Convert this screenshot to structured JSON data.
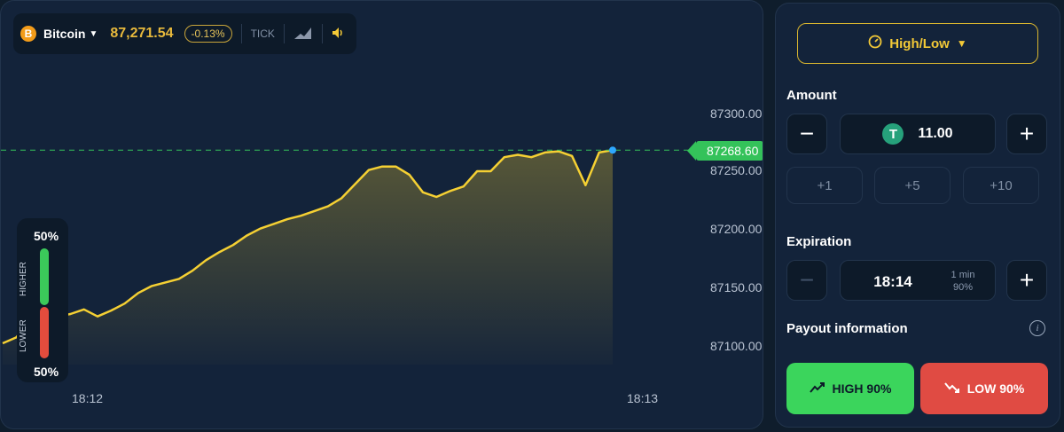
{
  "header": {
    "asset_icon": "B",
    "asset_name": "Bitcoin",
    "price": "87,271.54",
    "change": "-0.13%",
    "tick_label": "TICK"
  },
  "chart": {
    "price_labels": [
      "87300.00",
      "87250.00",
      "87200.00",
      "87150.00",
      "87100.00"
    ],
    "current_price": "87268.60",
    "time_labels": [
      "18:12",
      "18:13"
    ],
    "line_color": "#f5d033",
    "price_line_color": "#34c25a"
  },
  "sentiment": {
    "higher_percent": "50%",
    "lower_percent": "50%",
    "higher_label": "HIGHER",
    "lower_label": "LOWER"
  },
  "sidebar": {
    "mode": "High/Low",
    "amount_label": "Amount",
    "amount_value": "11.00",
    "currency_icon": "T",
    "minus": "−",
    "plus": "+",
    "quick_add": [
      "+1",
      "+5",
      "+10"
    ],
    "expiration_label": "Expiration",
    "expiration_time": "18:14",
    "expiration_duration": "1 min",
    "expiration_payout": "90%",
    "payout_label": "Payout information",
    "info_icon": "i",
    "high_button": "HIGH 90%",
    "low_button": "LOW 90%"
  },
  "colors": {
    "high": "#3bd55c",
    "low": "#e04b43",
    "accent": "#f3c937"
  },
  "chart_data": {
    "type": "area",
    "x": [
      "18:12",
      "18:13"
    ],
    "series": [
      {
        "values": [
          87103,
          87108,
          87122,
          87124,
          87126,
          87128,
          87132,
          87126,
          87131,
          87137,
          87146,
          87152,
          87155,
          87158,
          87165,
          87174,
          87181,
          87187,
          87195,
          87201,
          87205,
          87209,
          87212,
          87216,
          87220,
          87227,
          87239,
          87251,
          87254,
          87254,
          87247,
          87232,
          87228,
          87233,
          87237,
          87250,
          87250,
          87262,
          87264,
          87262,
          87266,
          87267,
          87263,
          87238,
          87266,
          87268
        ]
      }
    ],
    "ylim": [
      87080,
      87320
    ],
    "grid": false
  }
}
